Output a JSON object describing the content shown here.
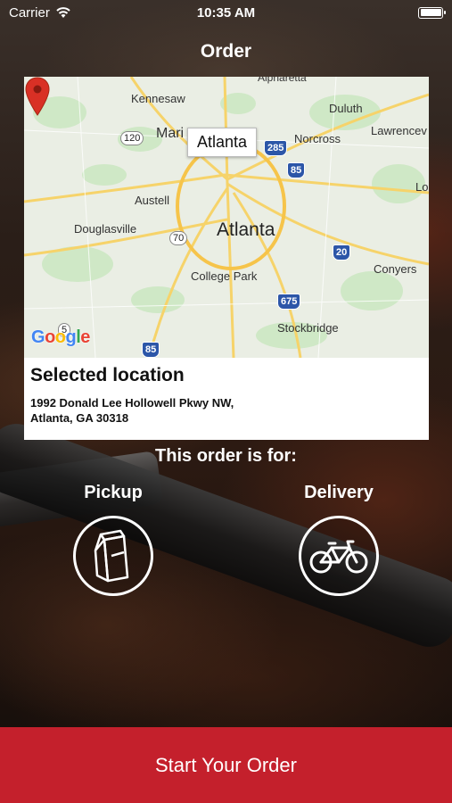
{
  "status_bar": {
    "carrier": "Carrier",
    "time": "10:35 AM",
    "wifi_icon": "wifi-icon",
    "battery_icon": "battery-icon"
  },
  "nav": {
    "title": "Order"
  },
  "map": {
    "callout": "Atlanta",
    "pin_icon": "map-pin-icon",
    "attribution": "Google",
    "labels": {
      "kennesaw": "Kennesaw",
      "alpharetta": "Alpharetta",
      "marietta": "Mari",
      "duluth": "Duluth",
      "norcross": "Norcross",
      "lawrenceville": "Lawrencev",
      "austell": "Austell",
      "douglasville": "Douglasville",
      "atlanta": "Atlanta",
      "college_park": "College Park",
      "conyers": "Conyers",
      "stockbridge": "Stockbridge",
      "lo": "Lo"
    },
    "shields": {
      "s120": "120",
      "s285": "285",
      "s85a": "85",
      "s70": "70",
      "s20": "20",
      "s675": "675",
      "s5": "5",
      "s85b": "85"
    }
  },
  "location": {
    "heading": "Selected location",
    "address_line1": "1992 Donald Lee Hollowell Pkwy NW,",
    "address_line2": "Atlanta, GA 30318"
  },
  "order_for": {
    "prompt": "This order is for:",
    "options": [
      {
        "label": "Pickup",
        "icon": "paper-bag-icon"
      },
      {
        "label": "Delivery",
        "icon": "bicycle-icon"
      }
    ]
  },
  "cta": {
    "label": "Start Your Order"
  },
  "colors": {
    "accent": "#c4202c",
    "pin": "#d93025"
  }
}
